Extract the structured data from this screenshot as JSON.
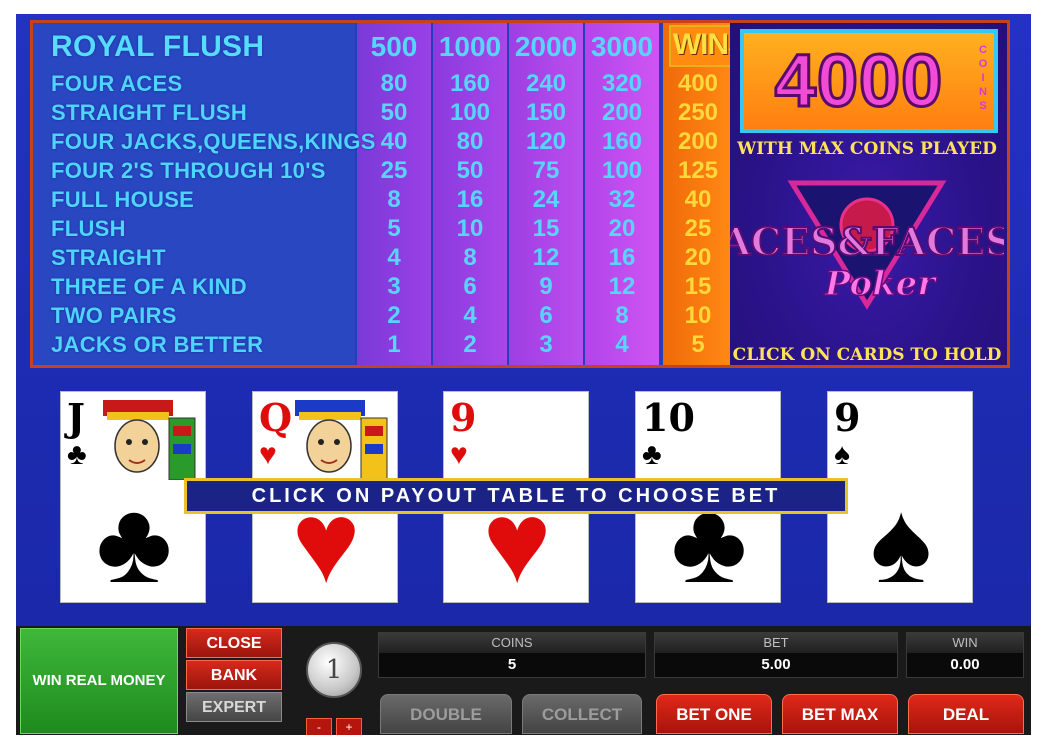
{
  "paytable": {
    "wins_label": "WINS",
    "bet_columns": [
      "500",
      "1000",
      "2000",
      "3000"
    ],
    "rows": [
      {
        "hand": "ROYAL FLUSH",
        "pays": [
          "500",
          "1000",
          "2000",
          "3000"
        ],
        "win": ""
      },
      {
        "hand": "FOUR ACES",
        "pays": [
          "80",
          "160",
          "240",
          "320"
        ],
        "win": "400"
      },
      {
        "hand": "STRAIGHT FLUSH",
        "pays": [
          "50",
          "100",
          "150",
          "200"
        ],
        "win": "250"
      },
      {
        "hand": "FOUR JACKS,QUEENS,KINGS",
        "pays": [
          "40",
          "80",
          "120",
          "160"
        ],
        "win": "200"
      },
      {
        "hand": "FOUR 2'S THROUGH 10'S",
        "pays": [
          "25",
          "50",
          "75",
          "100"
        ],
        "win": "125"
      },
      {
        "hand": "FULL HOUSE",
        "pays": [
          "8",
          "16",
          "24",
          "32"
        ],
        "win": "40"
      },
      {
        "hand": "FLUSH",
        "pays": [
          "5",
          "10",
          "15",
          "20"
        ],
        "win": "25"
      },
      {
        "hand": "STRAIGHT",
        "pays": [
          "4",
          "8",
          "12",
          "16"
        ],
        "win": "20"
      },
      {
        "hand": "THREE OF A KIND",
        "pays": [
          "3",
          "6",
          "9",
          "12"
        ],
        "win": "15"
      },
      {
        "hand": "TWO PAIRS",
        "pays": [
          "2",
          "4",
          "6",
          "8"
        ],
        "win": "10"
      },
      {
        "hand": "JACKS OR BETTER",
        "pays": [
          "1",
          "2",
          "3",
          "4"
        ],
        "win": "5"
      }
    ]
  },
  "promo": {
    "jackpot_amount": "4000",
    "jackpot_unit": "COINS",
    "max_coins_text": "WITH MAX COINS PLAYED",
    "logo_line1": "ACES&FACES",
    "logo_line2": "Poker",
    "hold_text": "CLICK ON CARDS TO HOLD"
  },
  "cards": [
    {
      "rank": "J",
      "suit": "♣",
      "color": "black"
    },
    {
      "rank": "Q",
      "suit": "♥",
      "color": "red"
    },
    {
      "rank": "9",
      "suit": "♥",
      "color": "red"
    },
    {
      "rank": "10",
      "suit": "♣",
      "color": "black"
    },
    {
      "rank": "9",
      "suit": "♠",
      "color": "black"
    }
  ],
  "banner_text": "CLICK ON PAYOUT TABLE TO CHOOSE BET",
  "controls": {
    "win_real_money": "WIN REAL MONEY",
    "close": "CLOSE",
    "bank": "BANK",
    "expert": "EXPERT",
    "coin_value": "1",
    "minus": "-",
    "plus": "+",
    "coins_label": "COINS",
    "coins_value": "5",
    "bet_label": "BET",
    "bet_value": "5.00",
    "win_label": "WIN",
    "win_value": "0.00",
    "double": "DOUBLE",
    "collect": "COLLECT",
    "bet_one": "BET ONE",
    "bet_max": "BET MAX",
    "deal": "DEAL"
  },
  "colors": {
    "table_border": "#c6421c",
    "wins_column": "#ff8a14",
    "hand_text": "#4fd3ff",
    "win_text": "#ffd83a"
  }
}
